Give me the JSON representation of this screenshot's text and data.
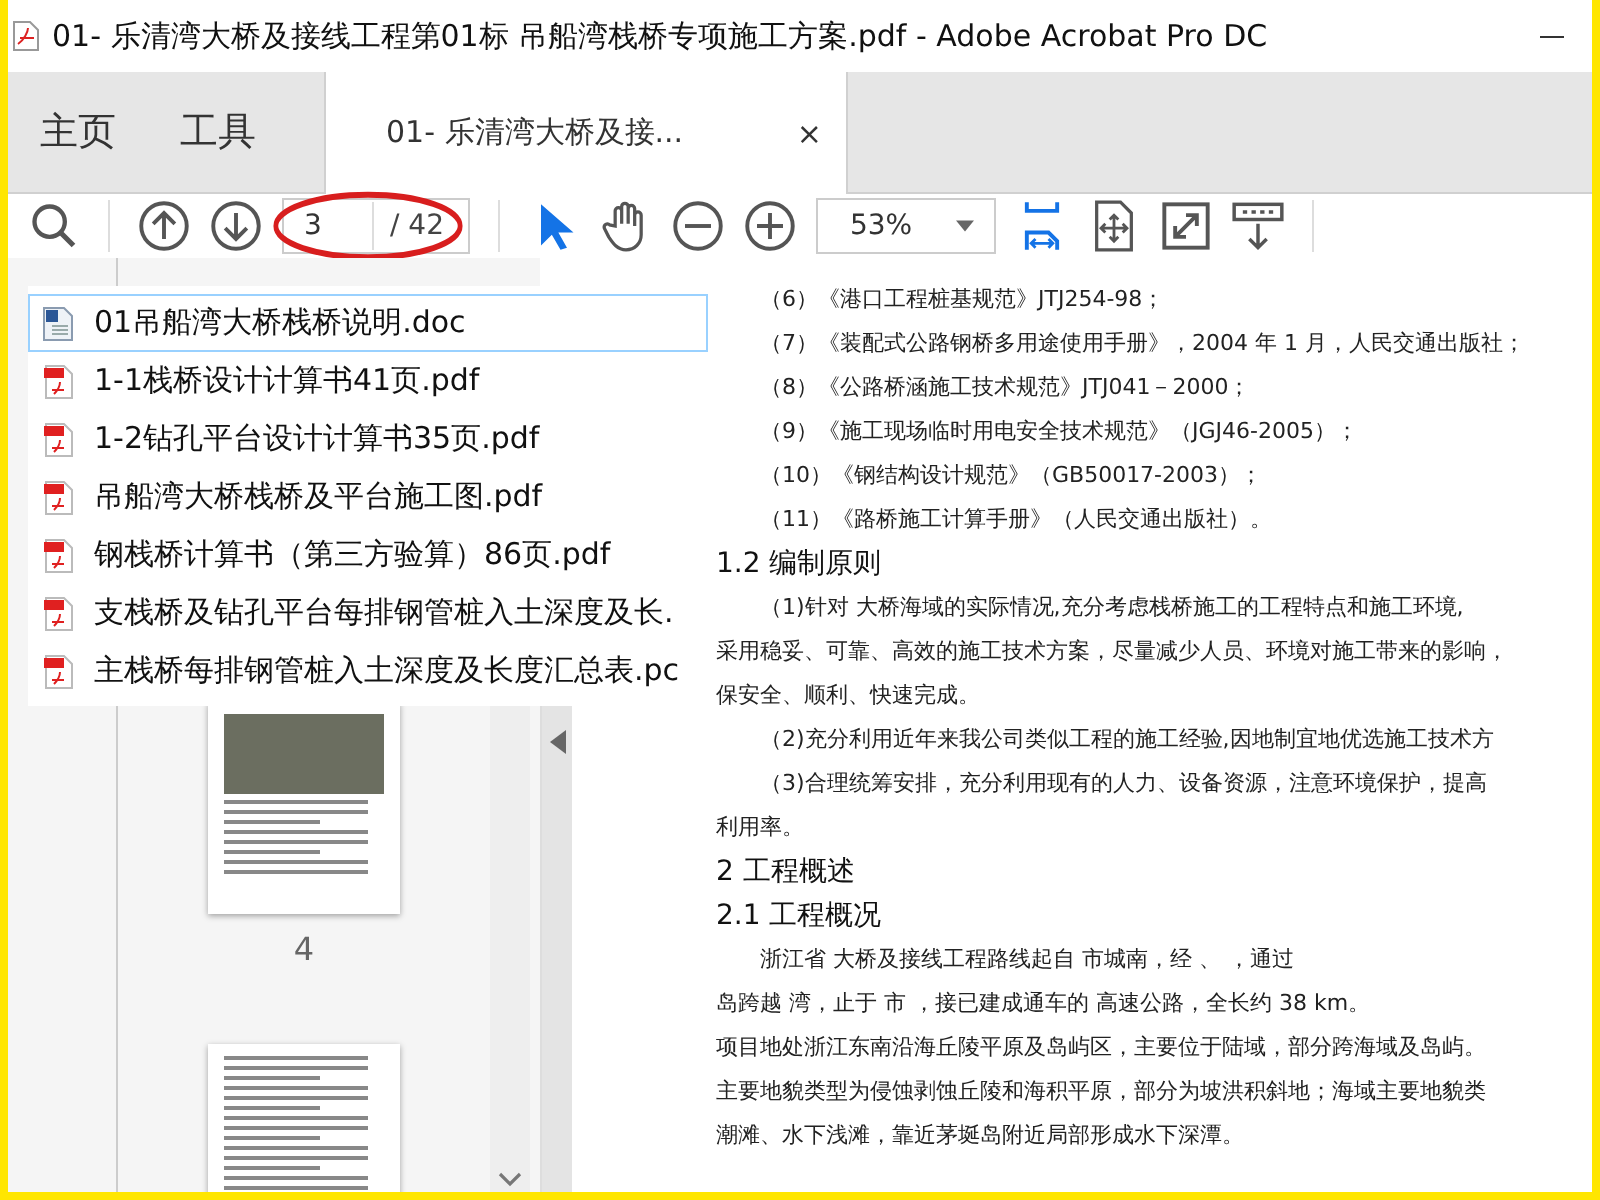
{
  "window": {
    "title": "01- 乐清湾大桥及接线工程第01标 吊船湾栈桥专项施工方案.pdf - Adobe Acrobat Pro DC"
  },
  "nav_tabs": [
    {
      "label": "主页",
      "selected": false
    },
    {
      "label": "工具",
      "selected": false
    },
    {
      "label": "01- 乐清湾大桥及接...",
      "selected": true,
      "close": "×"
    }
  ],
  "toolbar": {
    "page_current": "3",
    "page_total": "/ 42",
    "zoom": "53%",
    "tools": [
      {
        "kind": "pointer",
        "selected": true
      },
      {
        "kind": "hand",
        "selected": false
      }
    ]
  },
  "file_list": [
    {
      "name": "01吊船湾大桥栈桥说明.doc",
      "kind": "doc",
      "selected": true
    },
    {
      "name": "1-1栈桥设计计算书41页.pdf",
      "kind": "pdf",
      "selected": false
    },
    {
      "name": "1-2钻孔平台设计计算书35页.pdf",
      "kind": "pdf",
      "selected": false
    },
    {
      "name": "吊船湾大桥栈桥及平台施工图.pdf",
      "kind": "pdf",
      "selected": false
    },
    {
      "name": "钢栈桥计算书（第三方验算）86页.pdf",
      "kind": "pdf",
      "selected": false
    },
    {
      "name": "支栈桥及钻孔平台每排钢管桩入土深度及长.",
      "kind": "pdf",
      "selected": false
    },
    {
      "name": "主栈桥每排钢管桩入土深度及长度汇总表.pc",
      "kind": "pdf",
      "selected": false
    }
  ],
  "thumbnails": [
    {
      "label": "4",
      "photo": true
    },
    {
      "photo": false
    }
  ],
  "document": [
    {
      "kind": "item",
      "text": "（6）《港口工程桩基规范》JTJ254-98；"
    },
    {
      "kind": "item",
      "text": "（7）《装配式公路钢桥多用途使用手册》，2004 年 1 月，人民交通出版社；"
    },
    {
      "kind": "item",
      "text": "（8）《公路桥涵施工技术规范》JTJ041－2000；"
    },
    {
      "kind": "item",
      "text": "（9）《施工现场临时用电安全技术规范》（JGJ46-2005）；"
    },
    {
      "kind": "item",
      "text": "（10）《钢结构设计规范》（GB50017-2003）；"
    },
    {
      "kind": "item",
      "text": "（11）《路桥施工计算手册》（人民交通出版社）。"
    },
    {
      "kind": "heading",
      "text": "1.2 编制原则"
    },
    {
      "kind": "para",
      "text": "（1)针对 大桥海域的实际情况,充分考虑栈桥施工的工程特点和施工环境,"
    },
    {
      "kind": "line",
      "text": "采用稳妥、可靠、高效的施工技术方案，尽量减少人员、环境对施工带来的影响，"
    },
    {
      "kind": "line",
      "text": "保安全、顺利、快速完成。"
    },
    {
      "kind": "para",
      "text": "（2)充分利用近年来我公司类似工程的施工经验,因地制宜地优选施工技术方"
    },
    {
      "kind": "para",
      "text": "（3)合理统筹安排，充分利用现有的人力、设备资源，注意环境保护，提高"
    },
    {
      "kind": "line",
      "text": "利用率。"
    },
    {
      "kind": "heading",
      "text": "2 工程概述"
    },
    {
      "kind": "heading",
      "text": "2.1 工程概况"
    },
    {
      "kind": "para",
      "text": "浙江省 大桥及接线工程路线起自 市城南，经 、 ，通过"
    },
    {
      "kind": "line",
      "text": "岛跨越 湾，止于 市 ，接已建成通车的 高速公路，全长约 38 km。"
    },
    {
      "kind": "line",
      "text": "项目地处浙江东南沿海丘陵平原及岛屿区，主要位于陆域，部分跨海域及岛屿。"
    },
    {
      "kind": "line",
      "text": "主要地貌类型为侵蚀剥蚀丘陵和海积平原，部分为坡洪积斜地；海域主要地貌类"
    },
    {
      "kind": "line",
      "text": "潮滩、水下浅滩，靠近茅埏岛附近局部形成水下深潭。"
    }
  ]
}
